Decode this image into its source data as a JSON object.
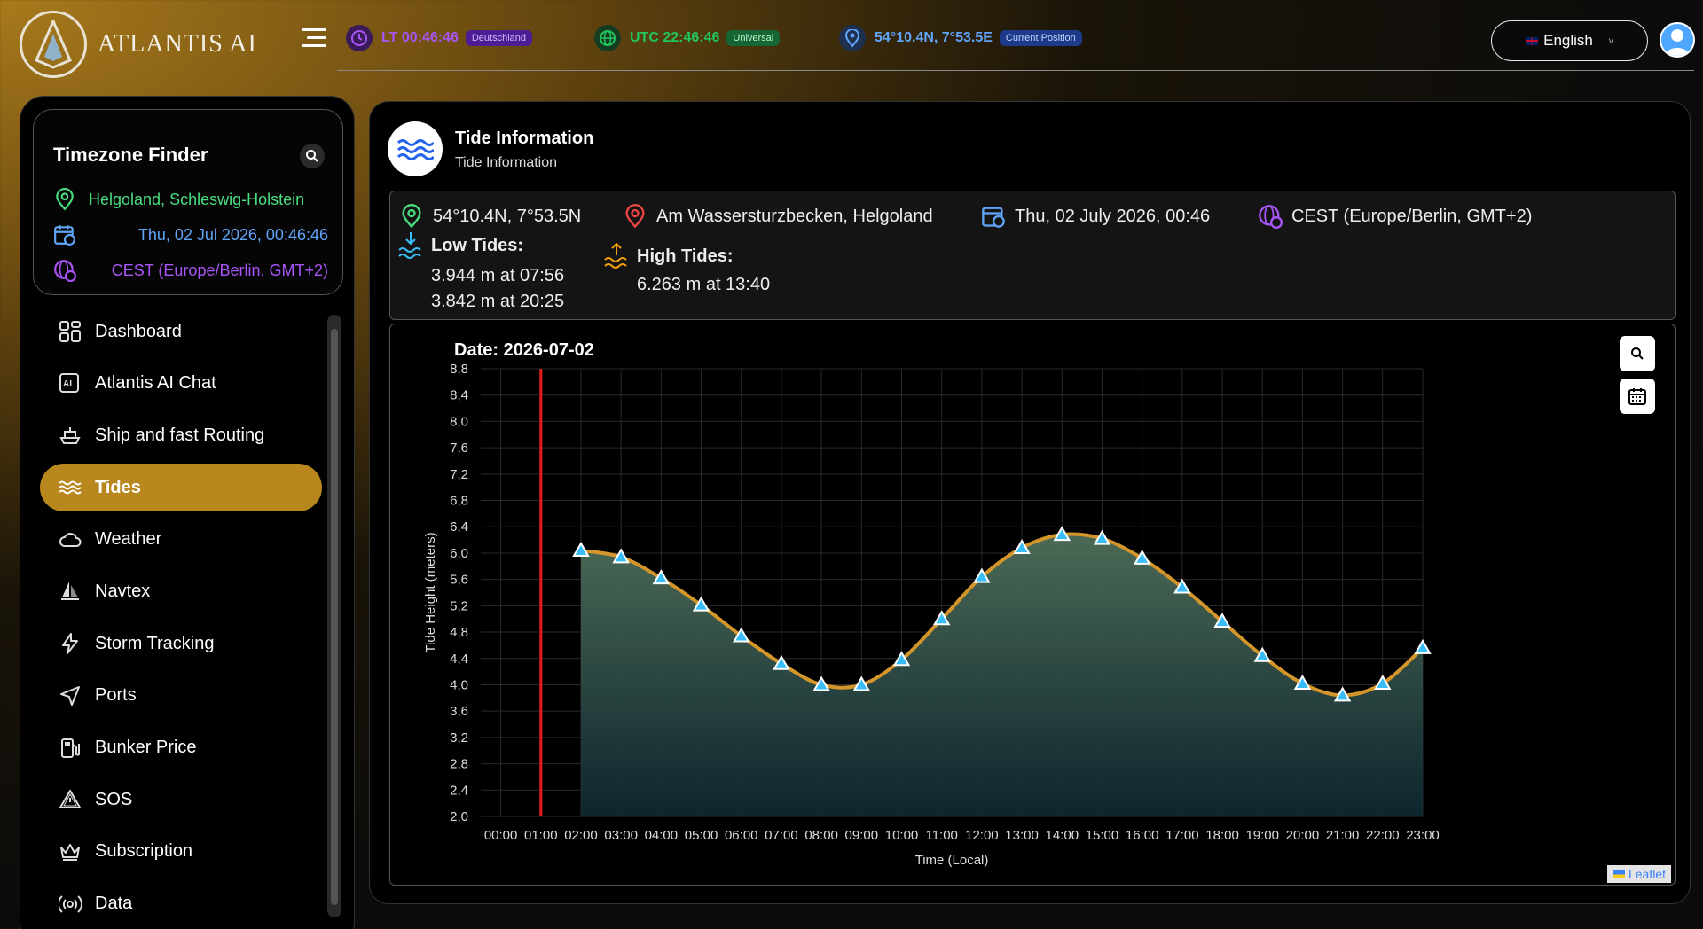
{
  "app": {
    "name": "ATLANTIS AI"
  },
  "topbar": {
    "lt": {
      "label": "LT",
      "time": "00:46:46",
      "badge": "Deutschland"
    },
    "utc": {
      "label": "UTC",
      "time": "22:46:46",
      "badge": "Universal"
    },
    "position": {
      "coords": "54°10.4N, 7°53.5E",
      "badge": "Current Position"
    },
    "language": "English"
  },
  "timezone_finder": {
    "title": "Timezone Finder",
    "location": "Helgoland, Schleswig-Holstein",
    "datetime": "Thu, 02 Jul 2026, 00:46:46",
    "zone": "CEST (Europe/Berlin, GMT+2)"
  },
  "nav": {
    "items": [
      {
        "label": "Dashboard",
        "icon": "grid-icon"
      },
      {
        "label": "Atlantis AI Chat",
        "icon": "ai-chat-icon"
      },
      {
        "label": "Ship and fast Routing",
        "icon": "ship-icon"
      },
      {
        "label": "Tides",
        "icon": "waves-icon",
        "active": true
      },
      {
        "label": "Weather",
        "icon": "cloud-icon"
      },
      {
        "label": "Navtex",
        "icon": "sailboat-icon"
      },
      {
        "label": "Storm Tracking",
        "icon": "lightning-icon"
      },
      {
        "label": "Ports",
        "icon": "navigation-icon"
      },
      {
        "label": "Bunker Price",
        "icon": "fuel-pump-icon"
      },
      {
        "label": "SOS",
        "icon": "warning-icon"
      },
      {
        "label": "Subscription",
        "icon": "crown-icon"
      },
      {
        "label": "Data",
        "icon": "broadcast-icon"
      }
    ]
  },
  "tide_panel": {
    "title": "Tide Information",
    "subtitle": "Tide Information",
    "coords": "54°10.4N, 7°53.5N",
    "place": "Am Wassersturzbecken, Helgoland",
    "date": "Thu, 02 July 2026, 00:46",
    "zone": "CEST (Europe/Berlin, GMT+2)",
    "low_tides": {
      "label": "Low Tides:",
      "entries": [
        "3.944 m at 07:56",
        "3.842 m at 20:25"
      ]
    },
    "high_tides": {
      "label": "High Tides:",
      "entries": [
        "6.263 m at 13:40"
      ]
    },
    "leaflet": "Leaflet"
  },
  "chart_data": {
    "type": "area",
    "title": "Date: 2026-07-02",
    "xlabel": "Time (Local)",
    "ylabel": "Tide Height (meters)",
    "x": [
      "00:00",
      "01:00",
      "02:00",
      "03:00",
      "04:00",
      "05:00",
      "06:00",
      "07:00",
      "08:00",
      "09:00",
      "10:00",
      "11:00",
      "12:00",
      "13:00",
      "14:00",
      "15:00",
      "16:00",
      "17:00",
      "18:00",
      "19:00",
      "20:00",
      "21:00",
      "22:00",
      "23:00"
    ],
    "series": [
      {
        "values": [
          null,
          null,
          6.04,
          5.94,
          5.62,
          5.21,
          4.74,
          4.32,
          4.0,
          4.0,
          4.38,
          5.0,
          5.64,
          6.08,
          6.28,
          6.22,
          5.92,
          5.48,
          4.96,
          4.44,
          4.02,
          3.84,
          4.02,
          4.56
        ],
        "color": "#d4962a"
      }
    ],
    "ylim": [
      2.0,
      8.8
    ],
    "yticks": [
      "2,0",
      "2,4",
      "2,8",
      "3,2",
      "3,6",
      "4,0",
      "4,4",
      "4,8",
      "5,2",
      "5,6",
      "6,0",
      "6,4",
      "6,8",
      "7,2",
      "7,6",
      "8,0",
      "8,4",
      "8,8"
    ],
    "current_time_marker": 1.0,
    "grid": true
  }
}
